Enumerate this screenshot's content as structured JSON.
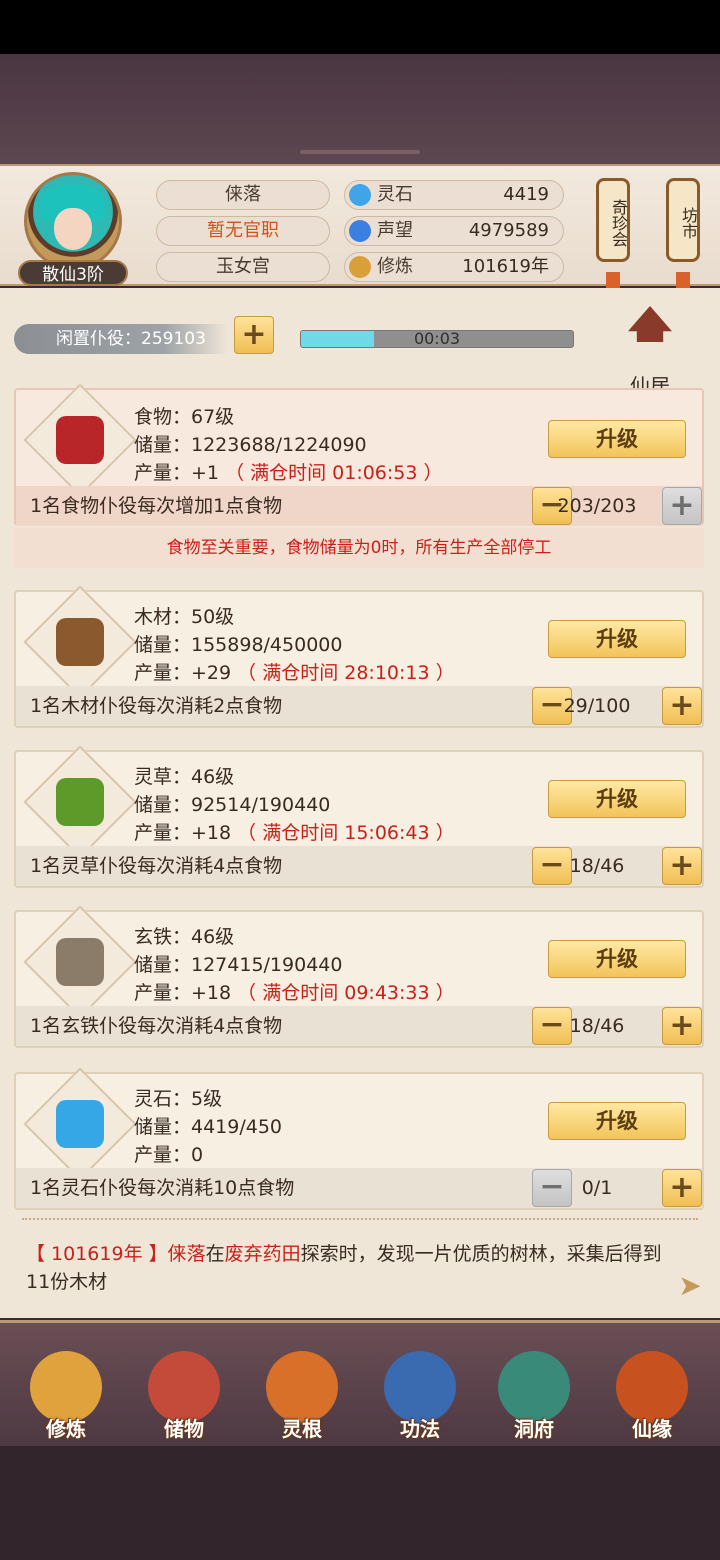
{
  "header": {
    "rank": "散仙3阶",
    "name": "俫落",
    "title": "暂无官职",
    "sect": "玉女宫",
    "stats": [
      {
        "label": "灵石",
        "value": "4419",
        "icon": "spirit-stone-icon",
        "color": "#3fa4e8"
      },
      {
        "label": "声望",
        "value": "4979589",
        "icon": "reputation-icon",
        "color": "#3b7fe0"
      },
      {
        "label": "修炼",
        "value": "101619年",
        "icon": "meditation-icon",
        "color": "#d9a03a"
      }
    ],
    "lantern_left": "奇珍会",
    "lantern_right": "坊市"
  },
  "idle": {
    "label": "闲置仆役：259103",
    "timer": "00:03",
    "progress_fraction": 0.27,
    "home_label": "仙居"
  },
  "cards": [
    {
      "name": "食物：67级",
      "storage": "储量：1223688/1224090",
      "output": "产量：+1",
      "full_time": "（ 满仓时间 01:06:53 ）",
      "upgrade": "升级",
      "footer": "1名食物仆役每次增加1点食物",
      "count": "203/203",
      "icon_color": "#b8262a"
    },
    {
      "name": "木材：50级",
      "storage": "储量：155898/450000",
      "output": "产量：+29",
      "full_time": "（ 满仓时间 28:10:13 ）",
      "upgrade": "升级",
      "footer": "1名木材仆役每次消耗2点食物",
      "count": "29/100",
      "icon_color": "#8a5a2e"
    },
    {
      "name": "灵草：46级",
      "storage": "储量：92514/190440",
      "output": "产量：+18",
      "full_time": "（ 满仓时间 15:06:43 ）",
      "upgrade": "升级",
      "footer": "1名灵草仆役每次消耗4点食物",
      "count": "18/46",
      "icon_color": "#5e9a2a"
    },
    {
      "name": "玄铁：46级",
      "storage": "储量：127415/190440",
      "output": "产量：+18",
      "full_time": "（ 满仓时间 09:43:33 ）",
      "upgrade": "升级",
      "footer": "1名玄铁仆役每次消耗4点食物",
      "count": "18/46",
      "icon_color": "#8b7c6a"
    },
    {
      "name": "灵石：5级",
      "storage": "储量：4419/450",
      "output": "产量：0",
      "full_time": "",
      "upgrade": "升级",
      "footer": "1名灵石仆役每次消耗10点食物",
      "count": "0/1",
      "icon_color": "#35a6e6"
    }
  ],
  "food_warning": "食物至关重要，食物储量为0时，所有生产全部停工",
  "log": {
    "year": "【 101619年 】",
    "name": "俫落",
    "middle": "在",
    "place": "废弃药田",
    "rest": "探索时，发现一片优质的树林，采集后得到11份木材"
  },
  "nav": [
    {
      "label": "修炼",
      "icon": "cultivation-icon",
      "color": "#e0a23c"
    },
    {
      "label": "储物",
      "icon": "storage-bag-icon",
      "color": "#c44a3a"
    },
    {
      "label": "灵根",
      "icon": "spirit-root-icon",
      "color": "#d9702a"
    },
    {
      "label": "功法",
      "icon": "manual-book-icon",
      "color": "#3a6ab0"
    },
    {
      "label": "洞府",
      "icon": "cave-house-icon",
      "color": "#3a8a7a"
    },
    {
      "label": "仙缘",
      "icon": "gourd-icon",
      "color": "#c8521f"
    }
  ]
}
